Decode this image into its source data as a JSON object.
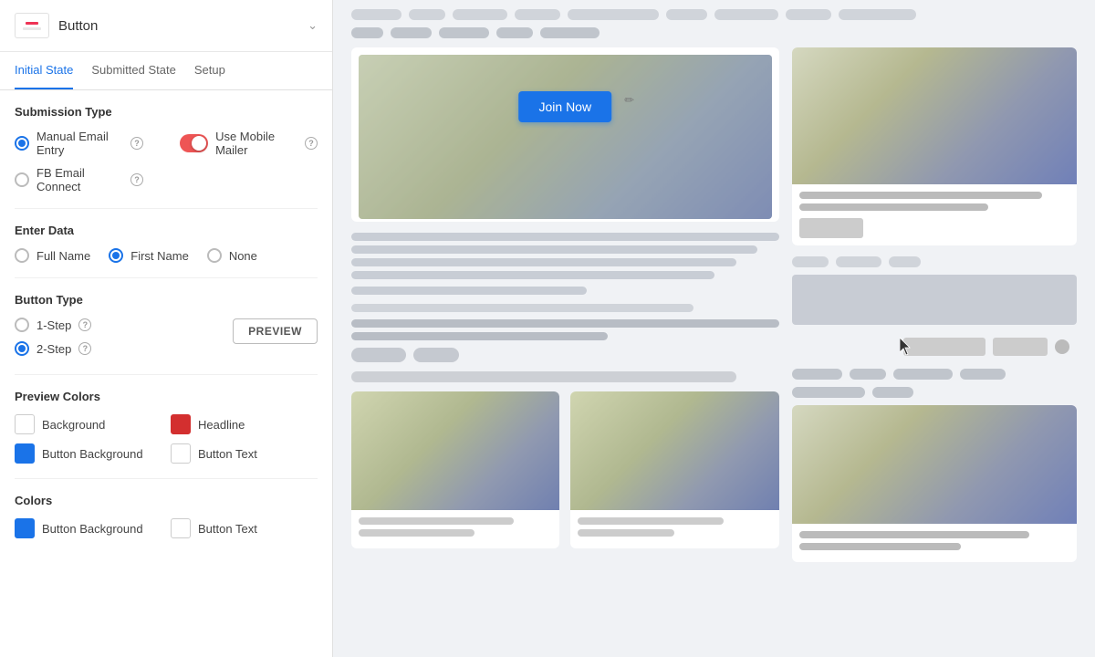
{
  "panel": {
    "title": "Button",
    "icon_label": "button-icon"
  },
  "tabs": [
    {
      "id": "initial",
      "label": "Initial State",
      "active": true
    },
    {
      "id": "submitted",
      "label": "Submitted State",
      "active": false
    },
    {
      "id": "setup",
      "label": "Setup",
      "active": false
    }
  ],
  "submission_type": {
    "title": "Submission Type",
    "options": [
      {
        "id": "manual",
        "label": "Manual Email Entry",
        "checked": true
      },
      {
        "id": "fb",
        "label": "FB Email Connect",
        "checked": false
      }
    ],
    "toggle_label": "Use Mobile Mailer",
    "toggle_on": true
  },
  "enter_data": {
    "title": "Enter Data",
    "options": [
      {
        "id": "full_name",
        "label": "Full Name",
        "checked": false
      },
      {
        "id": "first_name",
        "label": "First Name",
        "checked": true
      },
      {
        "id": "none",
        "label": "None",
        "checked": false
      }
    ]
  },
  "button_type": {
    "title": "Button Type",
    "options": [
      {
        "id": "one_step",
        "label": "1-Step",
        "checked": false
      },
      {
        "id": "two_step",
        "label": "2-Step",
        "checked": true
      }
    ],
    "preview_label": "PREVIEW"
  },
  "preview_colors": {
    "title": "Preview Colors",
    "items": [
      {
        "id": "bg",
        "label": "Background",
        "color": "white"
      },
      {
        "id": "headline",
        "label": "Headline",
        "color": "red"
      },
      {
        "id": "btn_bg",
        "label": "Button Background",
        "color": "blue"
      },
      {
        "id": "btn_text",
        "label": "Button Text",
        "color": "white"
      }
    ]
  },
  "colors": {
    "title": "Colors",
    "items": [
      {
        "id": "btn_bg",
        "label": "Button Background",
        "color": "blue"
      },
      {
        "id": "btn_text",
        "label": "Button Text",
        "color": "white"
      }
    ]
  },
  "right": {
    "join_button_label": "Join Now",
    "edit_icon": "✏"
  }
}
